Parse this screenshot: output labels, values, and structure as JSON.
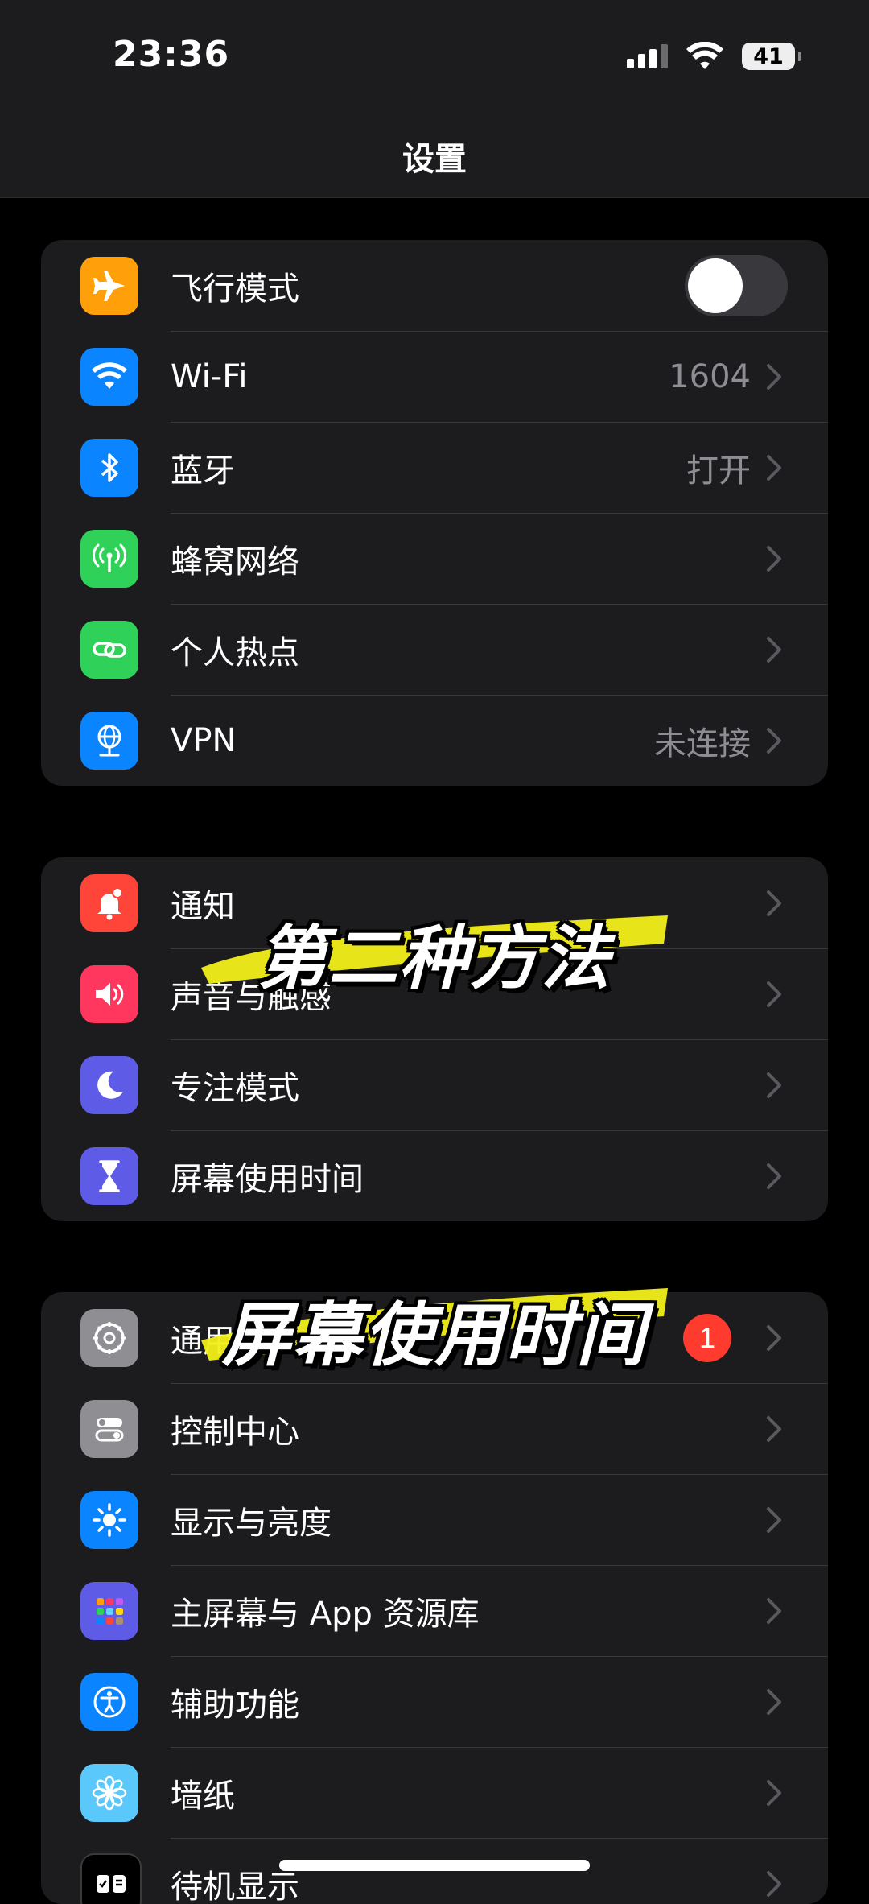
{
  "status_bar": {
    "time": "23:36",
    "battery": "41",
    "icons": [
      "cellular-signal-icon",
      "wifi-icon",
      "battery-icon"
    ]
  },
  "nav": {
    "title": "设置"
  },
  "groups": [
    {
      "rows": [
        {
          "label": "飞行模式",
          "value": "",
          "icon": "airplane-icon",
          "icon_color": "#ff9f0a",
          "control": "toggle-off"
        },
        {
          "label": "Wi-Fi",
          "value": "1604",
          "icon": "wifi-icon",
          "icon_color": "#0a84ff",
          "control": "chevron"
        },
        {
          "label": "蓝牙",
          "value": "打开",
          "icon": "bluetooth-icon",
          "icon_color": "#0a84ff",
          "control": "chevron"
        },
        {
          "label": "蜂窝网络",
          "value": "",
          "icon": "cellular-antenna-icon",
          "icon_color": "#30d158",
          "control": "chevron"
        },
        {
          "label": "个人热点",
          "value": "",
          "icon": "hotspot-link-icon",
          "icon_color": "#30d158",
          "control": "chevron"
        },
        {
          "label": "VPN",
          "value": "未连接",
          "icon": "globe-network-icon",
          "icon_color": "#0a84ff",
          "control": "chevron"
        }
      ]
    },
    {
      "rows": [
        {
          "label": "通知",
          "value": "",
          "icon": "bell-icon",
          "icon_color": "#ff453a",
          "control": "chevron"
        },
        {
          "label": "声音与触感",
          "value": "",
          "icon": "speaker-icon",
          "icon_color": "#ff375f",
          "control": "chevron"
        },
        {
          "label": "专注模式",
          "value": "",
          "icon": "moon-icon",
          "icon_color": "#5e5ce6",
          "control": "chevron"
        },
        {
          "label": "屏幕使用时间",
          "value": "",
          "icon": "hourglass-icon",
          "icon_color": "#5e5ce6",
          "control": "chevron"
        }
      ]
    },
    {
      "rows": [
        {
          "label": "通用",
          "value": "",
          "icon": "gear-icon",
          "icon_color": "#8e8e93",
          "control": "chevron",
          "badge": "1"
        },
        {
          "label": "控制中心",
          "value": "",
          "icon": "switches-icon",
          "icon_color": "#8e8e93",
          "control": "chevron"
        },
        {
          "label": "显示与亮度",
          "value": "",
          "icon": "sun-icon",
          "icon_color": "#0a84ff",
          "control": "chevron"
        },
        {
          "label": "主屏幕与 App 资源库",
          "value": "",
          "icon": "app-grid-icon",
          "icon_color": "#5e5ce6",
          "control": "chevron"
        },
        {
          "label": "辅助功能",
          "value": "",
          "icon": "accessibility-icon",
          "icon_color": "#0a84ff",
          "control": "chevron"
        },
        {
          "label": "墙纸",
          "value": "",
          "icon": "flower-icon",
          "icon_color": "#5ac8fa",
          "control": "chevron"
        },
        {
          "label": "待机显示",
          "value": "",
          "icon": "standby-icon",
          "icon_color": "#1c1c1e",
          "control": "chevron"
        }
      ]
    }
  ],
  "captions": [
    {
      "text": "第二种方法",
      "highlight_color": "#f2f01a"
    },
    {
      "text": "屏幕使用时间",
      "highlight_color": "#f2f01a"
    }
  ]
}
